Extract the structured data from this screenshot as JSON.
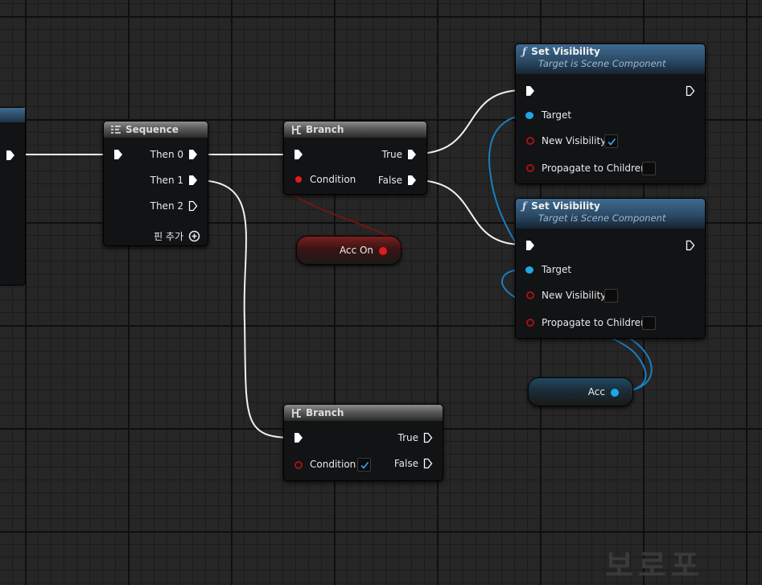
{
  "sequence_node": {
    "title": "Sequence",
    "outputs": [
      "Then 0",
      "Then 1",
      "Then 2"
    ],
    "add_pin_label": "핀 추가"
  },
  "branch_top": {
    "title": "Branch",
    "condition_label": "Condition",
    "true_label": "True",
    "false_label": "False"
  },
  "branch_bottom": {
    "title": "Branch",
    "condition_label": "Condition",
    "condition_checked": true,
    "true_label": "True",
    "false_label": "False"
  },
  "set_visibility_1": {
    "title": "Set Visibility",
    "subtitle": "Target is Scene Component",
    "target_label": "Target",
    "new_visibility_label": "New Visibility",
    "new_visibility_checked": true,
    "propagate_label": "Propagate to Children",
    "propagate_checked": false
  },
  "set_visibility_2": {
    "title": "Set Visibility",
    "subtitle": "Target is Scene Component",
    "target_label": "Target",
    "new_visibility_label": "New Visibility",
    "new_visibility_checked": false,
    "propagate_label": "Propagate to Children",
    "propagate_checked": false
  },
  "variables": {
    "acc_on": "Acc On",
    "acc": "Acc"
  },
  "icons": {
    "function": "function-f-icon",
    "sequence": "sequence-icon",
    "branch": "branch-icon",
    "add": "add-pin-icon"
  },
  "colors": {
    "exec_wire": "#ffffff",
    "bool_wire": "#8c0f0f",
    "object_wire": "#1a8fd6",
    "function_header": "#2b4a66",
    "bool_pin": "#e31b1b",
    "object_pin": "#1ea7e6"
  },
  "background_text": "보로포"
}
